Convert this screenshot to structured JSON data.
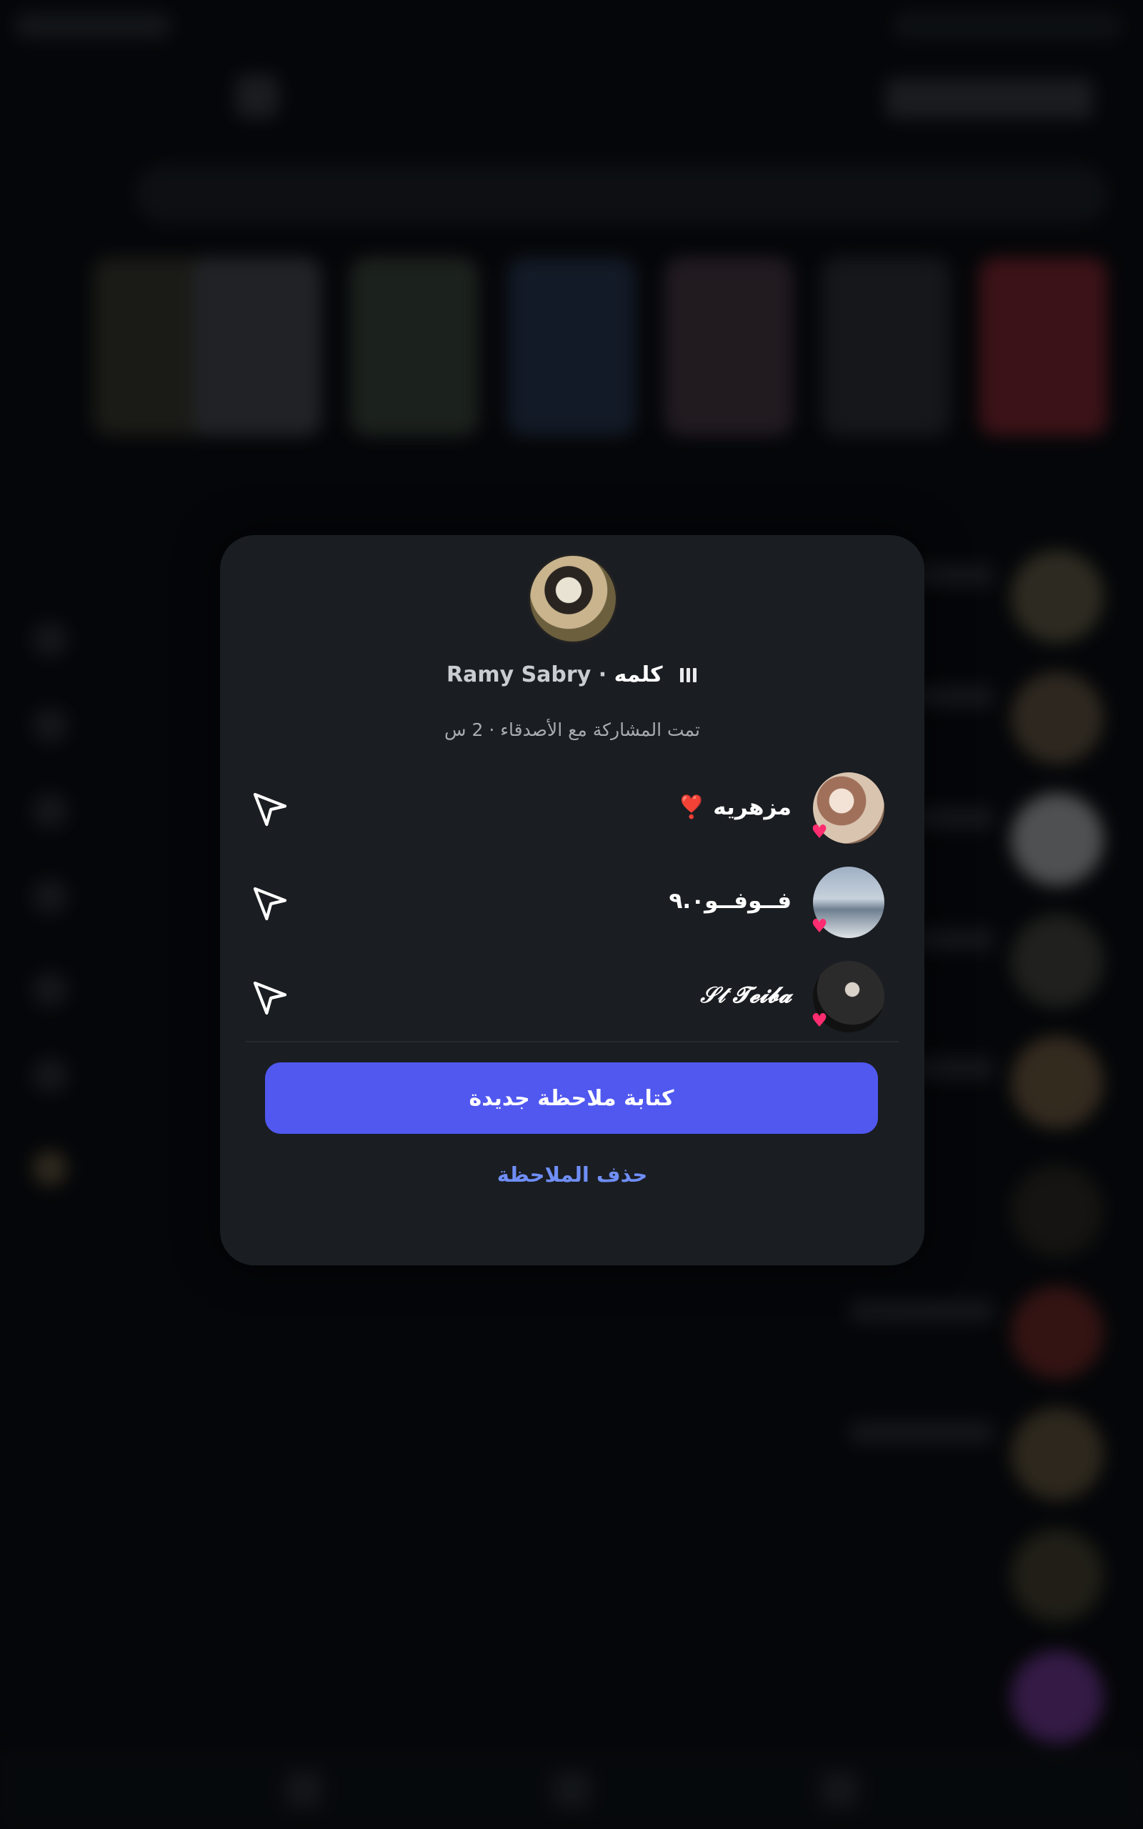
{
  "modal": {
    "author_name": "Ramy Sabry",
    "separator": "·",
    "note_text": "كلمه",
    "shared_info": "تمت المشاركة مع الأصدقاء · 2 س",
    "replies": [
      {
        "name": "مزهريه ❣️",
        "reaction": "heart"
      },
      {
        "name": "فــوفــو٩.٠",
        "reaction": "heart"
      },
      {
        "name": "𝒮𝓉 𝓣𝓮𝓲𝓫𝓪",
        "reaction": "heart"
      }
    ],
    "primary_button": "كتابة ملاحظة جديدة",
    "delete_button": "حذف الملاحظة"
  },
  "colors": {
    "modal_bg": "#1a1d21",
    "primary": "#5058f0",
    "link": "#6f8ef7",
    "heart": "#ff2d6f"
  },
  "icons": {
    "send": "paper-plane-icon",
    "reaction": "heart-icon"
  }
}
